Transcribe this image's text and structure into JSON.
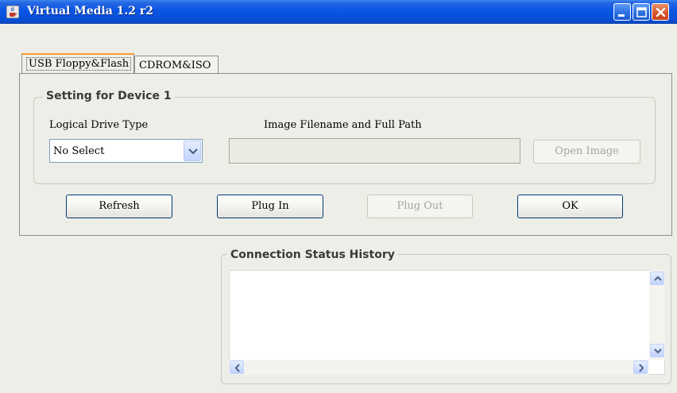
{
  "window": {
    "title": "Virtual Media 1.2 r2",
    "icons": [
      "java-cup-icon",
      "minimize-icon",
      "maximize-icon",
      "close-icon"
    ]
  },
  "tabs": [
    {
      "label": "USB Floppy&Flash",
      "selected": true
    },
    {
      "label": "CDROM&ISO",
      "selected": false
    }
  ],
  "device_group": {
    "title": "Setting for Device 1",
    "drive_type_label": "Logical Drive Type",
    "drive_type_value": "No Select",
    "image_path_label": "Image Filename and Full Path",
    "image_path_value": "",
    "open_image_label": "Open Image"
  },
  "actions": {
    "refresh": "Refresh",
    "plug_in": "Plug In",
    "plug_out": "Plug Out",
    "ok": "OK"
  },
  "status": {
    "title": "Connection Status History",
    "text": ""
  },
  "colors": {
    "titlebar": "#0a56e4",
    "tab_highlight": "#ff9c2a",
    "button_border": "#003c74",
    "disabled_text": "#a6a69d"
  }
}
